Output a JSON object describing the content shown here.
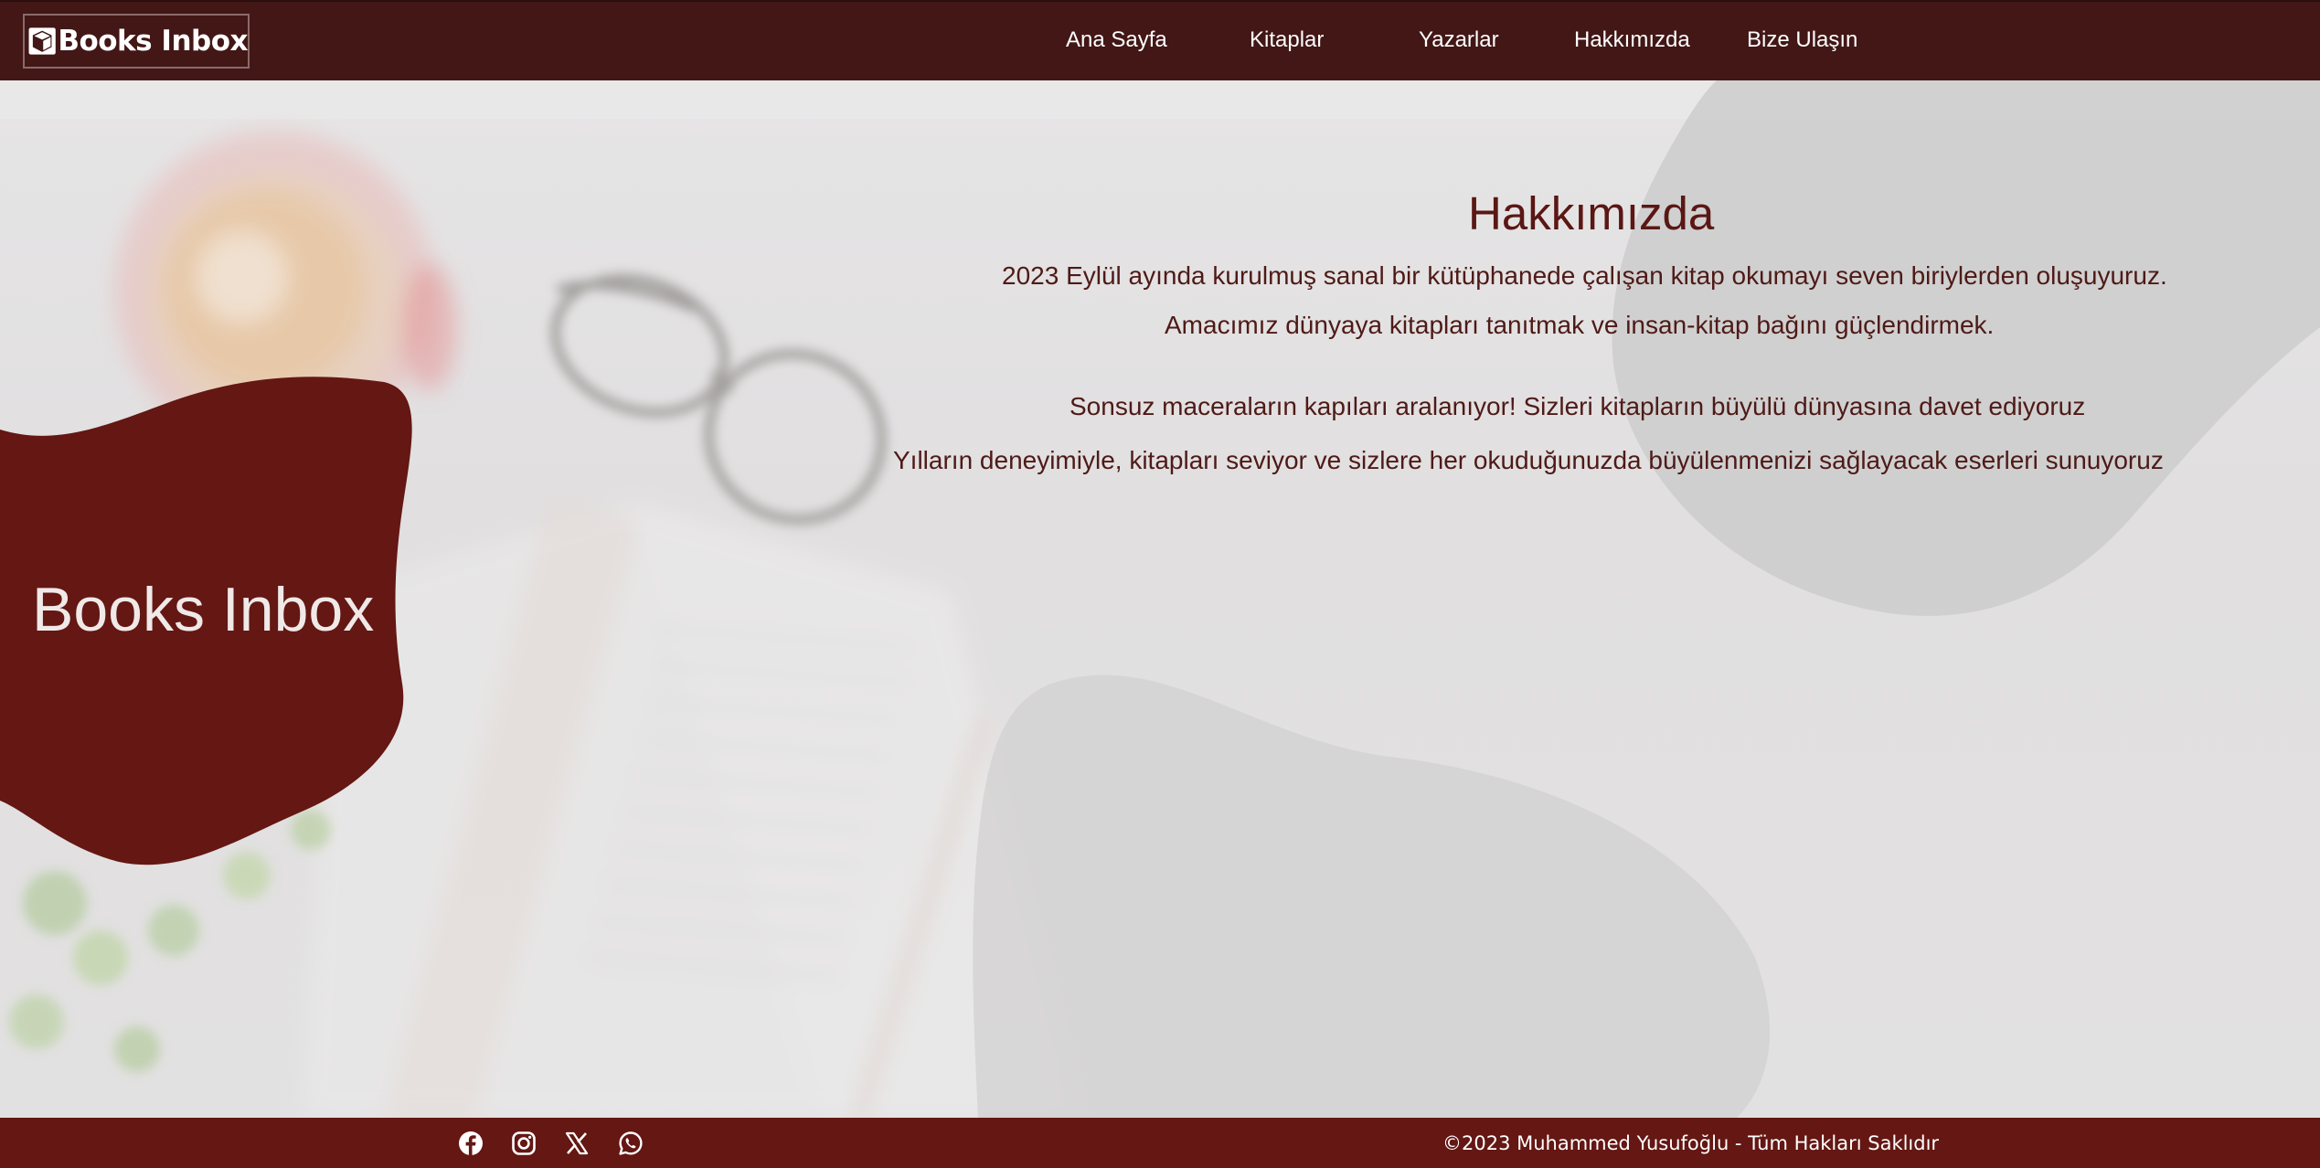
{
  "header": {
    "logo_text": "Books Inbox",
    "nav": [
      {
        "label": "Ana Sayfa"
      },
      {
        "label": "Kitaplar"
      },
      {
        "label": "Yazarlar"
      },
      {
        "label": "Hakkımızda"
      },
      {
        "label": "Bize Ulaşın"
      }
    ]
  },
  "hero": {
    "title": "Books Inbox"
  },
  "about": {
    "title": "Hakkımızda",
    "paragraphs": [
      "2023 Eylül ayında kurulmuş sanal bir kütüphanede çalışan kitap okumayı seven biriylerden oluşuyuruz.",
      "Amacımız dünyaya kitapları tanıtmak ve insan-kitap bağını güçlendirmek.",
      "Sonsuz maceraların kapıları aralanıyor! Sizleri kitapların büyülü dünyasına davet ediyoruz",
      "Yılların deneyimiyle, kitapları seviyor ve sizlere her okuduğunuzda büyülenmenizi sağlayacak eserleri sunuyoruz"
    ]
  },
  "footer": {
    "social_icons": [
      "facebook-icon",
      "instagram-icon",
      "x-icon",
      "whatsapp-icon"
    ],
    "copyright": "©2023 Muhammed Yusufoğlu - Tüm Hakları Saklıdır"
  },
  "colors": {
    "header_bg": "#421716",
    "footer_bg": "#641713",
    "accent": "#641713",
    "heading_text": "#5a1714"
  }
}
